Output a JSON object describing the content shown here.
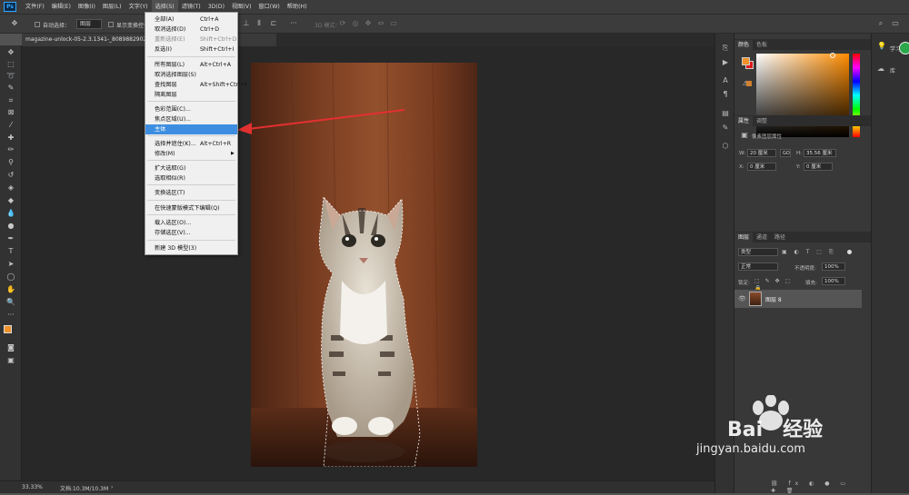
{
  "app": {
    "logo": "Ps"
  },
  "menubar": [
    "文件(F)",
    "编辑(E)",
    "图像(I)",
    "图层(L)",
    "文字(Y)",
    "选择(S)",
    "滤镜(T)",
    "3D(D)",
    "视图(V)",
    "窗口(W)",
    "帮助(H)"
  ],
  "options": {
    "auto_select_label": "自动选择：",
    "auto_select_value": "图层",
    "show_transform_label": "显示变换控件",
    "mode_label": "3D 模式："
  },
  "document": {
    "tab_title": "magazine-unlock-05-2.3.1341-_8089882902...(图层 8, RGB/8#) *"
  },
  "select_menu": {
    "items": [
      {
        "label": "全部(A)",
        "shortcut": "Ctrl+A",
        "disabled": false
      },
      {
        "label": "取消选择(D)",
        "shortcut": "Ctrl+D",
        "disabled": false
      },
      {
        "label": "重新选择(E)",
        "shortcut": "Shift+Ctrl+D",
        "disabled": true
      },
      {
        "label": "反选(I)",
        "shortcut": "Shift+Ctrl+I",
        "disabled": false
      },
      {
        "label": "所有图层(L)",
        "shortcut": "Alt+Ctrl+A",
        "disabled": false
      },
      {
        "label": "取消选择图层(S)",
        "shortcut": "",
        "disabled": false
      },
      {
        "label": "查找图层",
        "shortcut": "Alt+Shift+Ctrl+F",
        "disabled": false
      },
      {
        "label": "隔离图层",
        "shortcut": "",
        "disabled": false
      },
      {
        "label": "色彩范围(C)...",
        "shortcut": "",
        "disabled": false
      },
      {
        "label": "焦点区域(U)...",
        "shortcut": "",
        "disabled": false
      },
      {
        "label": "主体",
        "shortcut": "",
        "disabled": false,
        "highlighted": true
      },
      {
        "label": "选择并遮住(K)...",
        "shortcut": "Alt+Ctrl+R",
        "disabled": false
      },
      {
        "label": "修改(M)",
        "shortcut": "",
        "disabled": false,
        "submenu": true
      },
      {
        "label": "扩大选取(G)",
        "shortcut": "",
        "disabled": false
      },
      {
        "label": "选取相似(R)",
        "shortcut": "",
        "disabled": false
      },
      {
        "label": "变换选区(T)",
        "shortcut": "",
        "disabled": false
      },
      {
        "label": "在快速蒙版模式下编辑(Q)",
        "shortcut": "",
        "disabled": false
      },
      {
        "label": "载入选区(O)...",
        "shortcut": "",
        "disabled": false
      },
      {
        "label": "存储选区(V)...",
        "shortcut": "",
        "disabled": false
      },
      {
        "label": "新建 3D 模型(3)",
        "shortcut": "",
        "disabled": false
      }
    ]
  },
  "color_panel": {
    "tabs": [
      "颜色",
      "色板"
    ],
    "foreground": "#f0912a",
    "background": "#e01a1a"
  },
  "properties_panel": {
    "tabs": [
      "属性",
      "调整"
    ],
    "header": "像素图层属性",
    "w_label": "W:",
    "w_value": "20 厘米",
    "link_label": "GO",
    "h_label": "H:",
    "h_value": "35.56 厘米",
    "x_label": "X:",
    "x_value": "0 厘米",
    "y_label": "Y:",
    "y_value": "0 厘米"
  },
  "layers_panel": {
    "tabs": [
      "图层",
      "通道",
      "路径"
    ],
    "filter": "类型",
    "blend_mode": "正常",
    "opacity_label": "不透明度:",
    "opacity_value": "100%",
    "lock_label": "锁定:",
    "fill_label": "填充:",
    "fill_value": "100%",
    "layers": [
      {
        "name": "图层 8",
        "visible": true
      }
    ]
  },
  "right_strip": {
    "learn_label": "学习",
    "library_label": "库"
  },
  "status": {
    "zoom": "33.33%",
    "doc": "文档:10.3M/10.3M"
  },
  "watermark": {
    "brand": "Bai",
    "brand2": "经验",
    "url": "jingyan.baidu.com"
  }
}
